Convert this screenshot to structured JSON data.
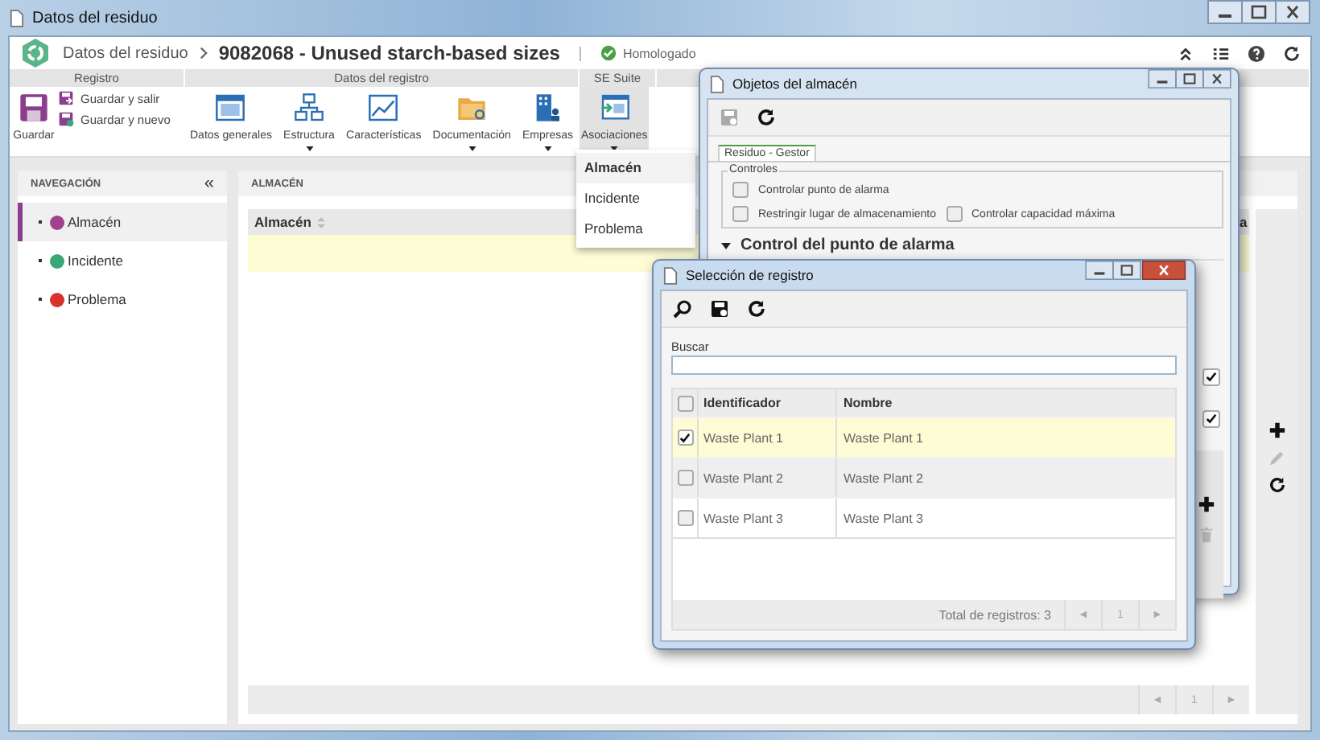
{
  "window": {
    "title": "Datos del residuo"
  },
  "header": {
    "section": "Datos del residuo",
    "record": "9082068 - Unused starch-based sizes",
    "status": "Homologado"
  },
  "ribbon": {
    "groups": [
      {
        "title": "Registro",
        "buttons": [
          {
            "kind": "save",
            "label": "Guardar"
          },
          {
            "kind": "save-exit",
            "label": "Guardar y salir"
          },
          {
            "kind": "save-new",
            "label": "Guardar y nuevo"
          }
        ]
      },
      {
        "title": "Datos del registro",
        "buttons": [
          {
            "kind": "general",
            "label": "Datos generales",
            "dropdown": false,
            "selected": false
          },
          {
            "kind": "structure",
            "label": "Estructura",
            "dropdown": true,
            "selected": false
          },
          {
            "kind": "chart",
            "label": "Características",
            "dropdown": false,
            "selected": false
          },
          {
            "kind": "folder",
            "label": "Documentación",
            "dropdown": true,
            "selected": false
          },
          {
            "kind": "building",
            "label": "Empresas",
            "dropdown": true,
            "selected": false
          }
        ]
      },
      {
        "title": "SE Suite",
        "buttons": [
          {
            "kind": "associations",
            "label": "Asociaciones",
            "dropdown": true,
            "selected": true
          }
        ]
      }
    ]
  },
  "menu": [
    {
      "label": "Almacén",
      "selected": true
    },
    {
      "label": "Incidente",
      "selected": false
    },
    {
      "label": "Problema",
      "selected": false
    }
  ],
  "navigation": {
    "title": "NAVEGACIÓN",
    "collapse": "«",
    "items": [
      {
        "label": "Almacén",
        "color": "#a0428f",
        "selected": true
      },
      {
        "label": "Incidente",
        "color": "#3aa776",
        "selected": false
      },
      {
        "label": "Problema",
        "color": "#d9312b",
        "selected": false
      }
    ]
  },
  "main": {
    "title": "ALMACÉN",
    "columns": [
      "Almacén",
      "a"
    ],
    "rows": [
      {
        "selected": true
      }
    ],
    "tools": [
      {
        "kind": "add",
        "disabled": false
      },
      {
        "kind": "edit",
        "disabled": true
      },
      {
        "kind": "refresh",
        "disabled": false
      }
    ],
    "pager": {
      "prev": "◄",
      "page": "1",
      "next": "►"
    }
  },
  "objects_dialog": {
    "title": "Objetos del almacén",
    "tools": [
      {
        "kind": "save",
        "disabled": true
      },
      {
        "kind": "refresh",
        "disabled": false
      }
    ],
    "tab": {
      "label": "Residuo - Gestor",
      "selected": true
    },
    "fieldset": "Controles",
    "checks": [
      {
        "label": "Controlar punto de alarma",
        "checked": false
      },
      {
        "label": "Restringir lugar de almacenamiento",
        "checked": false
      },
      {
        "label": "Controlar capacidad máxima",
        "checked": false
      }
    ],
    "section": {
      "label": "Control del punto de alarma",
      "expanded": true
    },
    "side_checks": [
      {
        "checked": true
      },
      {
        "checked": true
      }
    ],
    "side_tools": [
      {
        "kind": "add",
        "disabled": false
      },
      {
        "kind": "delete",
        "disabled": true
      }
    ]
  },
  "select_dialog": {
    "title": "Selección de registro",
    "tools": [
      {
        "kind": "search",
        "disabled": false
      },
      {
        "kind": "save",
        "disabled": false
      },
      {
        "kind": "refresh",
        "disabled": false
      }
    ],
    "search": {
      "label": "Buscar"
    },
    "header_checked": false,
    "columns": [
      "Identificador",
      "Nombre"
    ],
    "rows": [
      {
        "id": "Waste Plant 1",
        "name": "Waste Plant 1",
        "checked": true,
        "selected": true
      },
      {
        "id": "Waste Plant 2",
        "name": "Waste Plant 2",
        "checked": false,
        "selected": false
      },
      {
        "id": "Waste Plant 3",
        "name": "Waste Plant 3",
        "checked": false,
        "selected": false
      }
    ],
    "total": "Total de registros: 3",
    "pager": {
      "prev": "◄",
      "page": "1",
      "next": "►"
    }
  }
}
